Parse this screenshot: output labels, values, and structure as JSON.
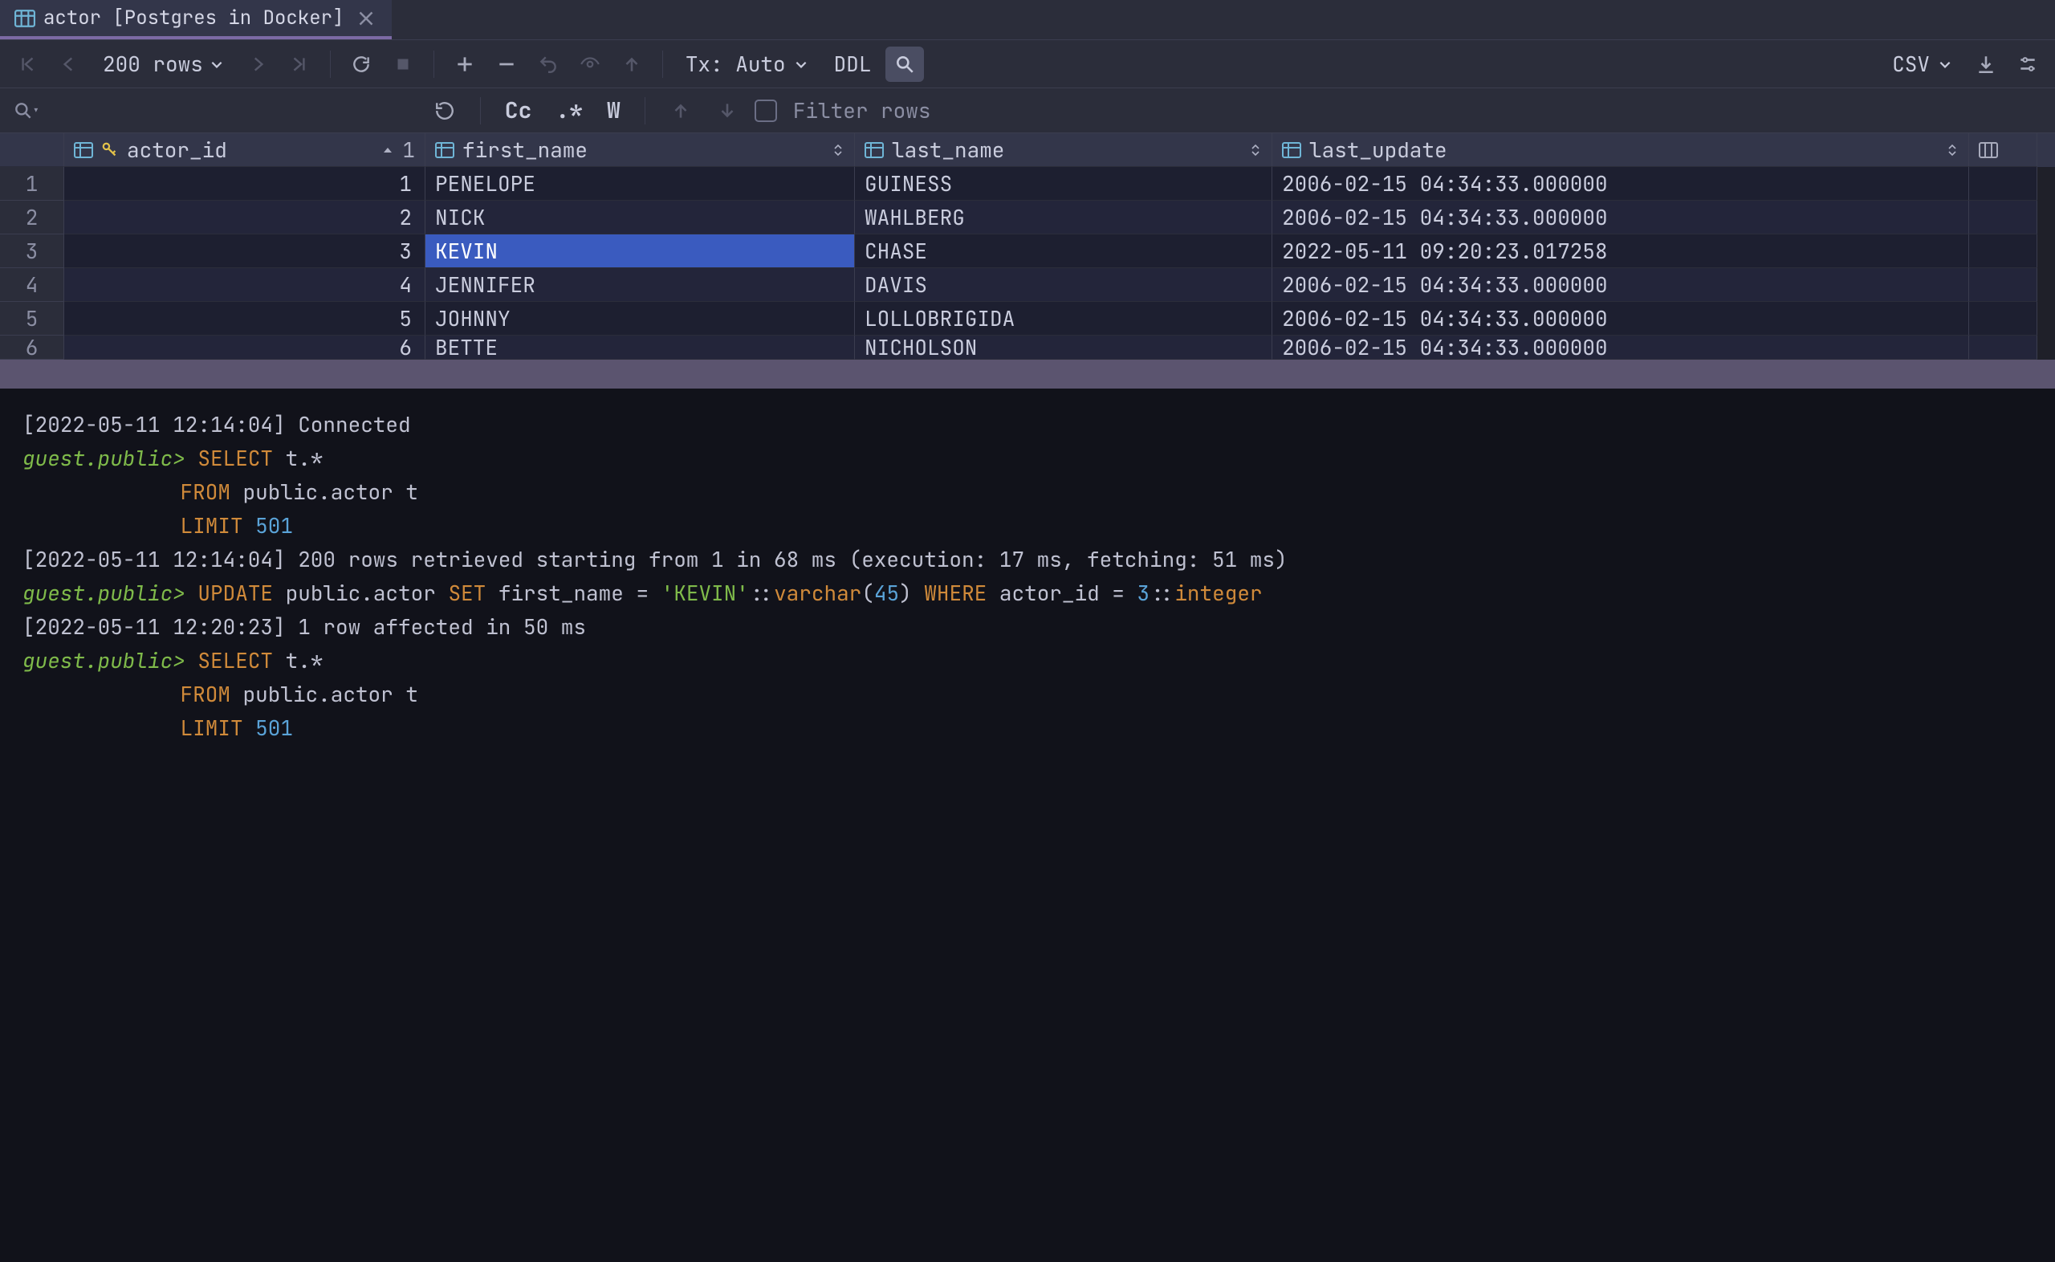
{
  "tab": {
    "title": "actor [Postgres in Docker]"
  },
  "toolbar": {
    "rows_label": "200 rows",
    "tx_label": "Tx: Auto",
    "ddl_label": "DDL",
    "export_label": "CSV"
  },
  "filter": {
    "cc": "Cc",
    "star": ".*",
    "w": "W",
    "placeholder": "Filter rows"
  },
  "columns": {
    "actor_id": {
      "label": "actor_id",
      "sort_index": "1"
    },
    "first_name": {
      "label": "first_name"
    },
    "last_name": {
      "label": "last_name"
    },
    "last_update": {
      "label": "last_update"
    }
  },
  "rows": [
    {
      "n": "1",
      "actor_id": "1",
      "first_name": "PENELOPE",
      "last_name": "GUINESS",
      "last_update": "2006-02-15 04:34:33.000000"
    },
    {
      "n": "2",
      "actor_id": "2",
      "first_name": "NICK",
      "last_name": "WAHLBERG",
      "last_update": "2006-02-15 04:34:33.000000"
    },
    {
      "n": "3",
      "actor_id": "3",
      "first_name": "KEVIN",
      "last_name": "CHASE",
      "last_update": "2022-05-11 09:20:23.017258"
    },
    {
      "n": "4",
      "actor_id": "4",
      "first_name": "JENNIFER",
      "last_name": "DAVIS",
      "last_update": "2006-02-15 04:34:33.000000"
    },
    {
      "n": "5",
      "actor_id": "5",
      "first_name": "JOHNNY",
      "last_name": "LOLLOBRIGIDA",
      "last_update": "2006-02-15 04:34:33.000000"
    },
    {
      "n": "6",
      "actor_id": "6",
      "first_name": "BETTE",
      "last_name": "NICHOLSON",
      "last_update": "2006-02-15 04:34:33.000000"
    }
  ],
  "selected": {
    "row": "3",
    "col": "first_name"
  },
  "console": {
    "l1": "[2022-05-11 12:14:04] Connected",
    "prompt": "guest.public>",
    "q1_a": "SELECT t.*",
    "q1_b": "FROM public.actor t",
    "q1_c": "LIMIT 501",
    "l2": "[2022-05-11 12:14:04] 200 rows retrieved starting from 1 in 68 ms (execution: 17 ms, fetching: 51 ms)",
    "u1": "UPDATE public.actor SET first_name = 'KEVIN'::varchar(45) WHERE actor_id = 3::integer",
    "l3": "[2022-05-11 12:20:23] 1 row affected in 50 ms"
  }
}
